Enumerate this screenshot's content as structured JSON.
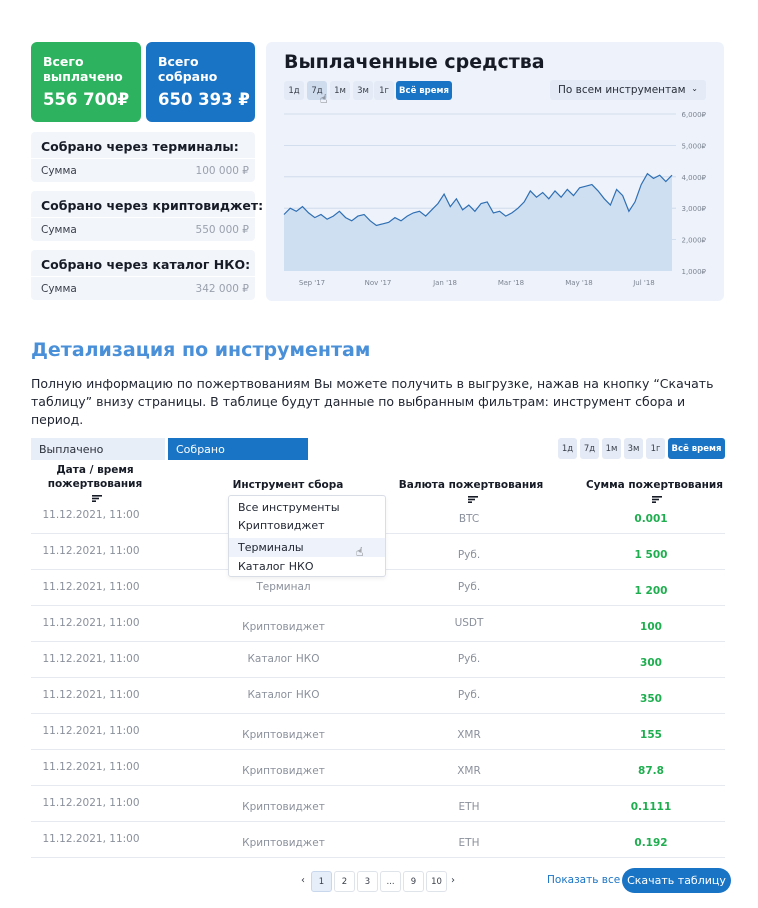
{
  "totals": {
    "paid_label": "Всего выплачено",
    "paid_value": "556 700₽",
    "collected_label": "Всего собрано",
    "collected_value": "650 393 ₽"
  },
  "collect_sources": [
    {
      "title": "Собрано через терминалы:",
      "key": "Сумма",
      "value": "100 000 ₽"
    },
    {
      "title": "Собрано через криптовиджет:",
      "key": "Сумма",
      "value": "550 000 ₽"
    },
    {
      "title": "Собрано через каталог НКО:",
      "key": "Сумма",
      "value": "342 000 ₽"
    }
  ],
  "chart_panel": {
    "title": "Выплаченные средства",
    "periods": [
      "1д",
      "7д",
      "1м",
      "3м",
      "1г",
      "Всё время"
    ],
    "active_period": "Всё время",
    "instrument_select": "По всем инструментам"
  },
  "chart_data": {
    "type": "area",
    "x_ticks": [
      "Sep '17",
      "Nov '17",
      "Jan '18",
      "Mar '18",
      "May '18",
      "Jul '18"
    ],
    "y_ticks": [
      "1,000₽",
      "2,000₽",
      "3,000₽",
      "4,000₽",
      "5,000₽",
      "6,000₽"
    ],
    "ylim": [
      1000,
      6000
    ],
    "values": [
      2800,
      3000,
      2900,
      3050,
      2850,
      2700,
      2800,
      2650,
      2750,
      2900,
      2700,
      2600,
      2750,
      2800,
      2600,
      2450,
      2500,
      2550,
      2700,
      2600,
      2750,
      2850,
      2900,
      2750,
      2950,
      3150,
      3450,
      3050,
      3300,
      2950,
      3100,
      2900,
      3150,
      3200,
      2850,
      2900,
      2750,
      2850,
      3000,
      3200,
      3550,
      3350,
      3500,
      3300,
      3550,
      3350,
      3600,
      3400,
      3650,
      3700,
      3750,
      3550,
      3300,
      3100,
      3600,
      3400,
      2900,
      3200,
      3750,
      4100,
      3950,
      4050,
      3850,
      4050
    ],
    "grid": true
  },
  "details": {
    "title": "Детализация по инструментам",
    "text": "Полную информацию по пожертвованиям Вы можете получить в выгрузке, нажав на кнопку “Скачать таблицу” внизу страницы. В таблице будут данные по выбранным фильтрам: инструмент сбора и период."
  },
  "tabs": {
    "paid": "Выплачено",
    "collected": "Собрано"
  },
  "table": {
    "headers": {
      "date": "Дата / время пожертвования",
      "instrument": "Инструмент сбора",
      "currency": "Валюта пожертвования",
      "sum": "Сумма пожертвования"
    },
    "rows": [
      {
        "date": "11.12.2021, 11:00",
        "instrument": "",
        "currency": "BTC",
        "sum": "0.001"
      },
      {
        "date": "11.12.2021, 11:00",
        "instrument": "",
        "currency": "Руб.",
        "sum": "1 500"
      },
      {
        "date": "11.12.2021, 11:00",
        "instrument": "Терминал",
        "currency": "Руб.",
        "sum": "1 200"
      },
      {
        "date": "11.12.2021, 11:00",
        "instrument": "Криптовиджет",
        "currency": "USDT",
        "sum": "100"
      },
      {
        "date": "11.12.2021, 11:00",
        "instrument": "Каталог НКО",
        "currency": "Руб.",
        "sum": "300"
      },
      {
        "date": "11.12.2021, 11:00",
        "instrument": "Каталог НКО",
        "currency": "Руб.",
        "sum": "350"
      },
      {
        "date": "11.12.2021, 11:00",
        "instrument": "Криптовиджет",
        "currency": "XMR",
        "sum": "155"
      },
      {
        "date": "11.12.2021, 11:00",
        "instrument": "Криптовиджет",
        "currency": "XMR",
        "sum": "87.8"
      },
      {
        "date": "11.12.2021, 11:00",
        "instrument": "Криптовиджет",
        "currency": "ETH",
        "sum": "0.1111"
      },
      {
        "date": "11.12.2021, 11:00",
        "instrument": "Криптовиджет",
        "currency": "ETH",
        "sum": "0.192"
      }
    ]
  },
  "instrument_dropdown": {
    "options": [
      "Все инструменты",
      "Криптовиджет",
      "Терминалы",
      "Каталог НКО"
    ],
    "hovered": "Терминалы"
  },
  "pagination": {
    "pages": [
      "1",
      "2",
      "3",
      "...",
      "9",
      "10"
    ],
    "current": "1",
    "prev": "‹",
    "next": "›"
  },
  "footer": {
    "show_all": "Показать все",
    "download": "Скачать таблицу"
  },
  "colors": {
    "green": "#2db35f",
    "blue": "#1a74c5",
    "panel_bg": "#eef3fb",
    "sum_green": "#1fae4f"
  }
}
